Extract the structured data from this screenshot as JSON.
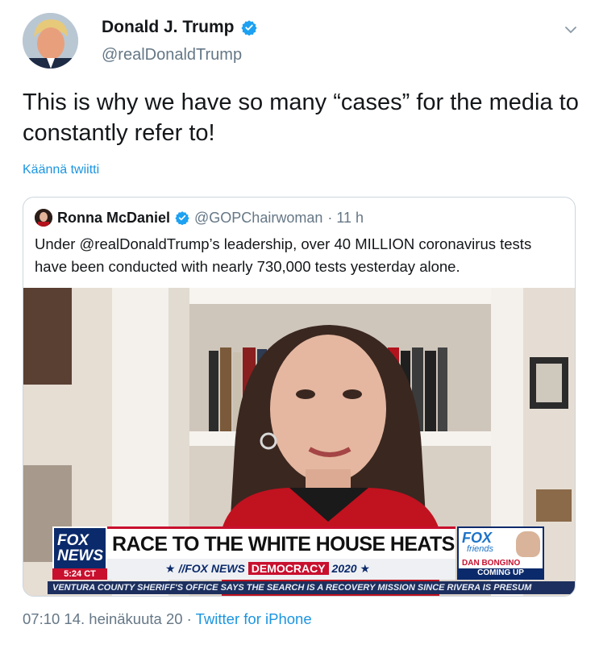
{
  "author": {
    "name": "Donald J. Trump",
    "handle": "@realDonaldTrump",
    "verified": true,
    "avatar_icon": "profile-photo"
  },
  "tweet": {
    "text": "This is why we have so many “cases” for the media to constantly refer to!",
    "translate_label": "Käännä twiitti"
  },
  "quoted_tweet": {
    "name": "Ronna McDaniel",
    "handle": "@GOPChairwoman",
    "time": "· 11 h",
    "text": "Under @realDonaldTrump’s leadership, over 40 MILLION coronavirus tests have been conducted with nearly 730,000 tests yesterday alone.",
    "video": {
      "logo_line1": "FOX",
      "logo_line2": "NEWS",
      "clock": "5:24 CT",
      "headline": "RACE TO THE WHITE HOUSE HEATS UP",
      "subline_prefix": "★ //FOX NEWS",
      "subline_badge": "DEMOCRACY",
      "subline_suffix": "2020 ★",
      "show_name": "FOX",
      "show_sub": "friends",
      "host": "DAN BONGINO",
      "coming_up": "COMING UP",
      "ticker": "VENTURA COUNTY SHERIFF'S OFFICE SAYS THE SEARCH IS A RECOVERY MISSION SINCE RIVERA IS PRESUM"
    }
  },
  "footer": {
    "time": "07:10 14. heinäkuuta 20",
    "separator": " · ",
    "source": "Twitter for iPhone"
  },
  "colors": {
    "link": "#1b95e0",
    "muted": "#657786",
    "text": "#14171a",
    "fox_red": "#c8102e",
    "fox_blue": "#0b2a6b"
  }
}
